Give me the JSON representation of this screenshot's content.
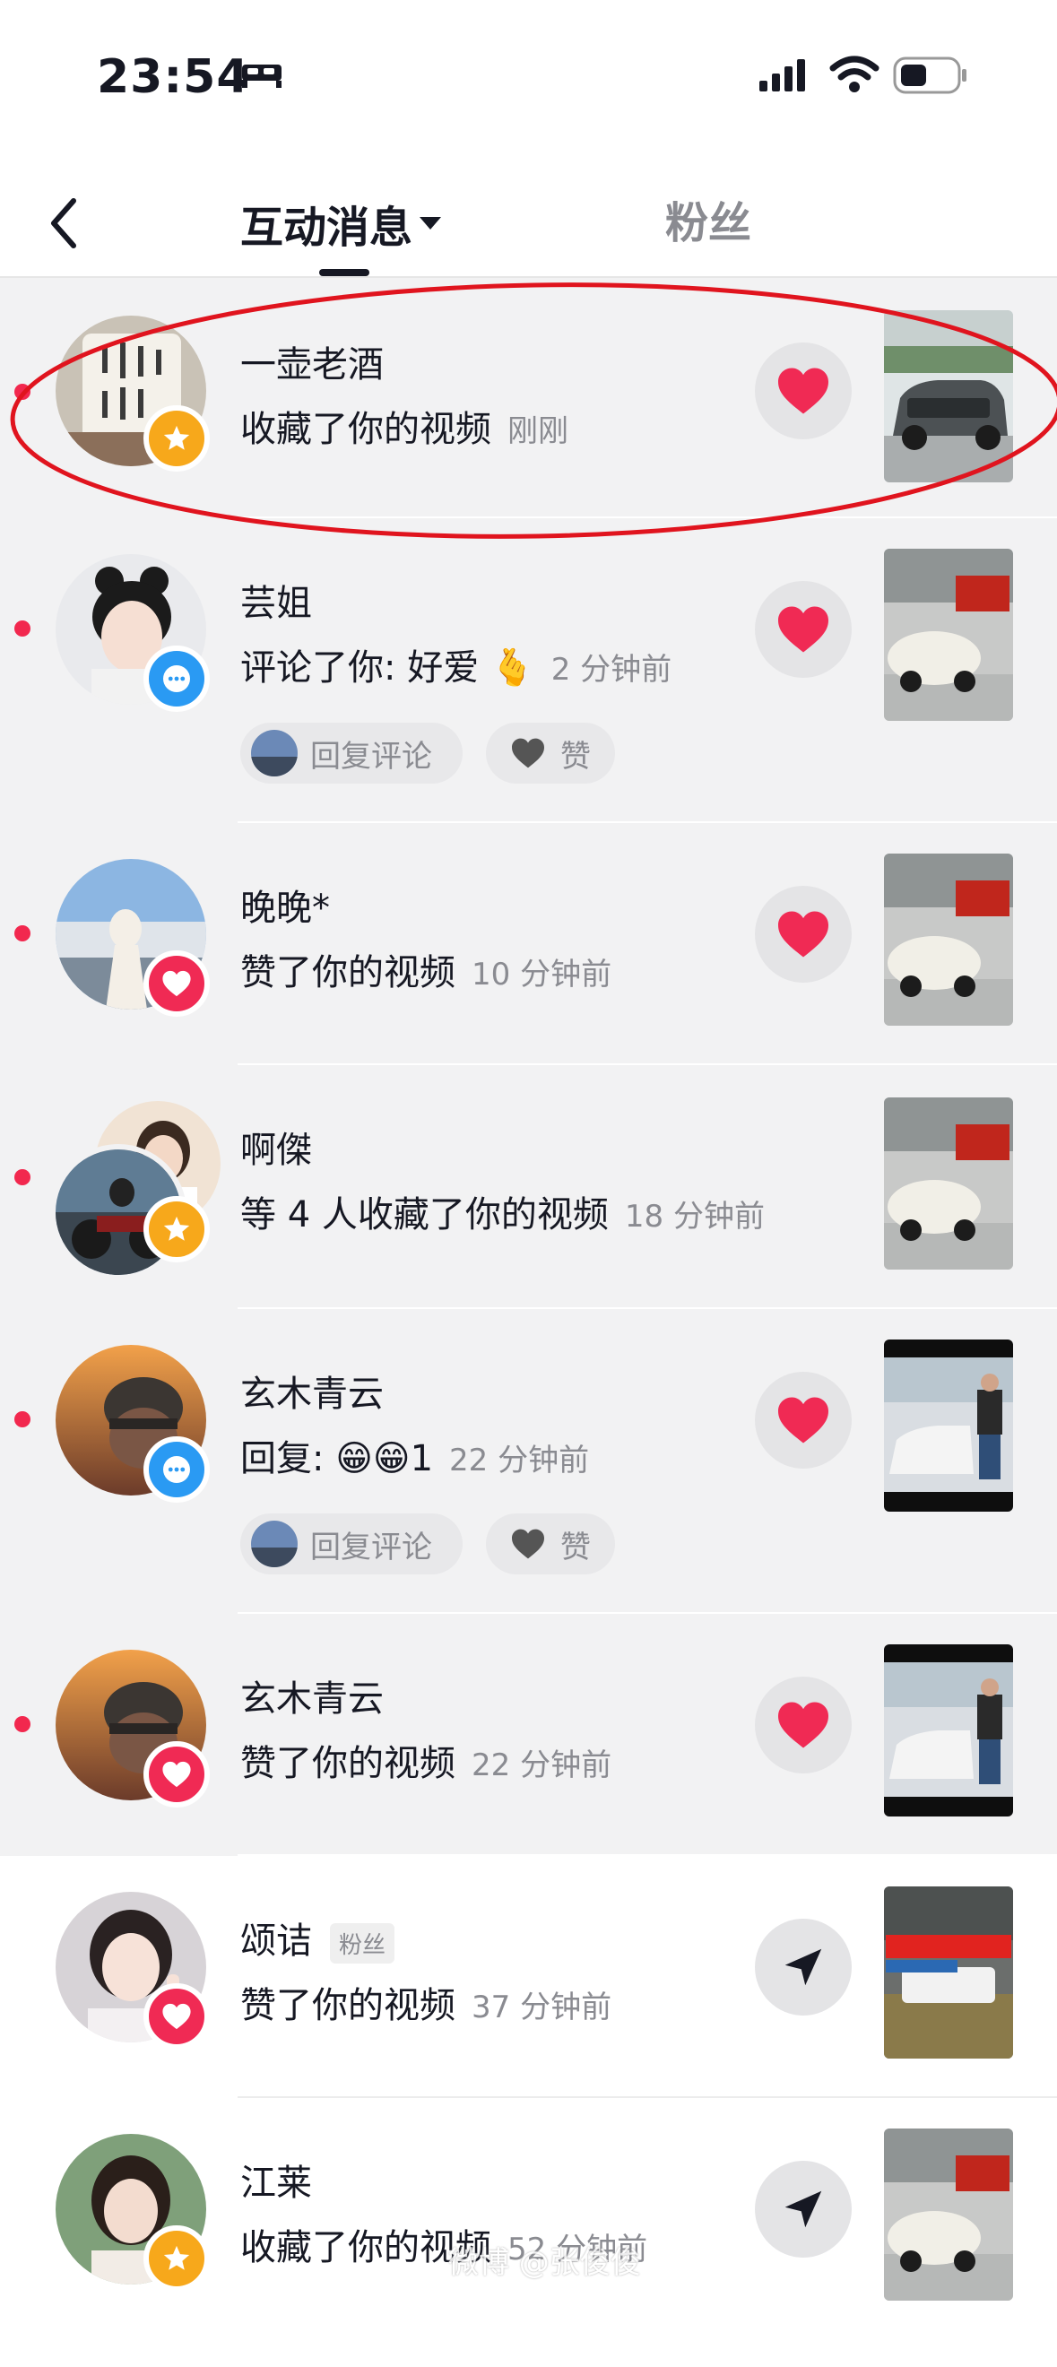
{
  "status_bar": {
    "time": "23:54",
    "icons": [
      "bed-icon",
      "signal-icon",
      "wifi-icon",
      "battery-icon"
    ]
  },
  "nav": {
    "tab_interactions": "互动消息",
    "tab_fans": "粉丝",
    "icons": [
      "back-icon",
      "caret-down-icon"
    ]
  },
  "rows": [
    {
      "name": "一壶老酒",
      "action": "收藏了你的视频",
      "time": "刚刚",
      "badge": "star",
      "button": "heart",
      "unread": true
    },
    {
      "name": "芸姐",
      "action": "评论了你: 好爱 🫰",
      "time": "2 分钟前",
      "badge": "comment",
      "button": "heart",
      "unread": true,
      "chips": {
        "reply": "回复评论",
        "like": "赞"
      }
    },
    {
      "name": "晚晚*",
      "action": "赞了你的视频",
      "time": "10 分钟前",
      "badge": "like",
      "button": "heart",
      "unread": true
    },
    {
      "name": "啊傑",
      "action": "等 4 人收藏了你的视频",
      "time": "18 分钟前",
      "badge": "star",
      "button": "none",
      "unread": true
    },
    {
      "name": "玄木青云",
      "action": "回复: 😁😁1",
      "time": "22 分钟前",
      "badge": "comment",
      "button": "heart",
      "unread": true,
      "chips": {
        "reply": "回复评论",
        "like": "赞"
      }
    },
    {
      "name": "玄木青云",
      "action": "赞了你的视频",
      "time": "22 分钟前",
      "badge": "like",
      "button": "heart",
      "unread": true
    },
    {
      "name": "颂诘",
      "tag": "粉丝",
      "action": "赞了你的视频",
      "time": "37 分钟前",
      "badge": "like",
      "button": "send",
      "unread": false
    },
    {
      "name": "江莱",
      "action": "收藏了你的视频",
      "time": "52 分钟前",
      "badge": "star",
      "button": "send",
      "unread": false
    }
  ],
  "watermark": "微博 @张俊俊",
  "colors": {
    "unread_dot": "#f2284e",
    "like_red": "#f02a54",
    "star_yellow": "#f7a81b",
    "comment_blue": "#2a9af3",
    "unread_bg": "#f2f2f3",
    "annotation_red": "#e0141e"
  }
}
